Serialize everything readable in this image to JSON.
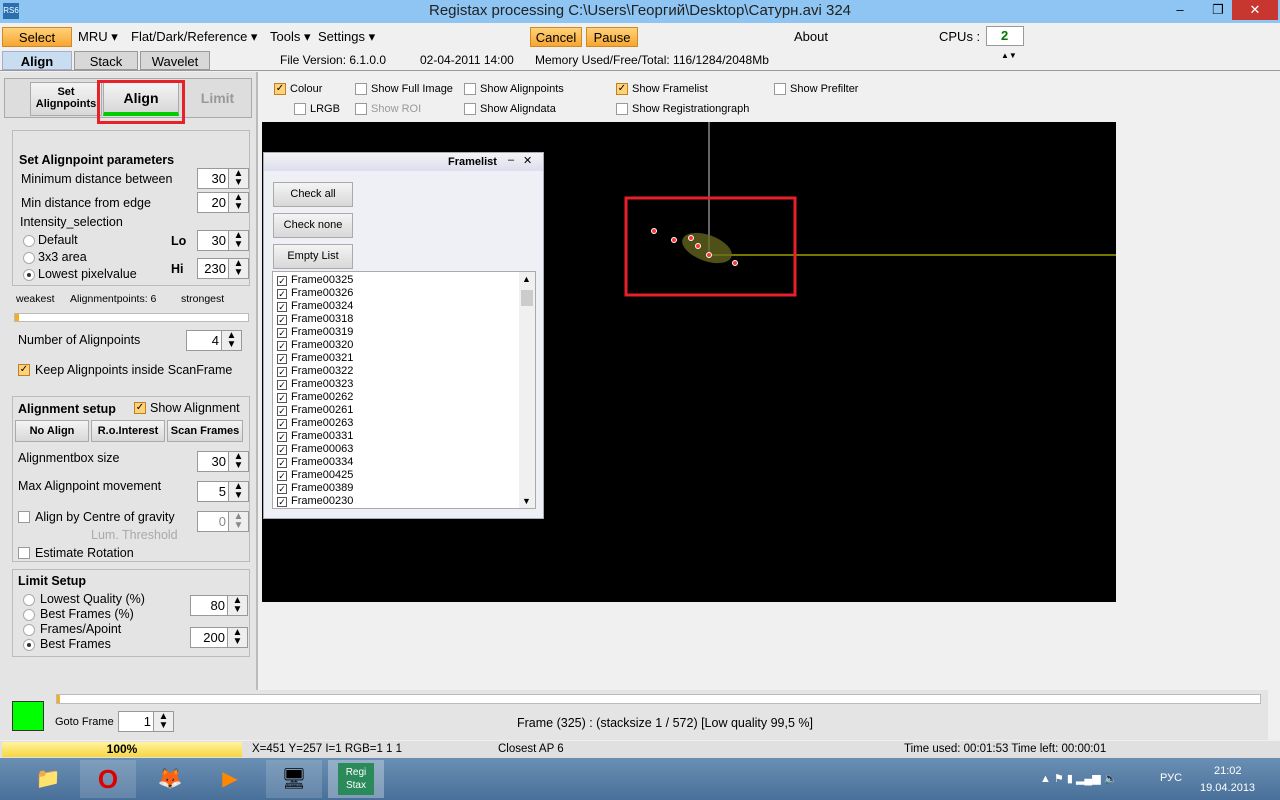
{
  "window": {
    "title": "Registax processing C:\\Users\\Георгий\\Desktop\\Сатурн.avi 324",
    "app_icon": "RS6",
    "minimize": "–",
    "restore": "❐",
    "close": "✕"
  },
  "menu": {
    "select": "Select",
    "mru": "MRU ▾",
    "flat": "Flat/Dark/Reference ▾",
    "tools": "Tools ▾",
    "settings": "Settings ▾",
    "cancel": "Cancel",
    "pause": "Pause",
    "about": "About",
    "cpus_label": "CPUs :",
    "cpus_value": "2"
  },
  "tabs": [
    "Align",
    "Stack",
    "Wavelet"
  ],
  "info": {
    "version": "File Version: 6.1.0.0",
    "date": "02-04-2011 14:00",
    "memory": "Memory Used/Free/Total: 116/1284/2048Mb"
  },
  "subtabs": {
    "set_alignpoints": "Set Alignpoints",
    "align": "Align",
    "limit": "Limit"
  },
  "options": {
    "colour": "Colour",
    "lrgb": "LRGB",
    "show_full_image": "Show Full Image",
    "show_roi": "Show ROI",
    "show_alignpoints": "Show Alignpoints",
    "show_aligndata": "Show Aligndata",
    "show_framelist": "Show Framelist",
    "show_registrationgraph": "Show Registrationgraph",
    "show_prefilter": "Show Prefilter"
  },
  "alignpoint": {
    "heading": "Set Alignpoint parameters",
    "min_between": "Minimum distance between",
    "min_between_val": "30",
    "min_edge": "Min distance from edge",
    "min_edge_val": "20",
    "intensity": "Intensity_selection",
    "default": "Default",
    "area": "3x3 area",
    "lowest": "Lowest pixelvalue",
    "lo": "Lo",
    "lo_val": "30",
    "hi": "Hi",
    "hi_val": "230",
    "weakest": "weakest",
    "count": "Alignmentpoints: 6",
    "strongest": "strongest",
    "slider_fraction": 0.0,
    "num_label": "Number of Alignpoints",
    "num_val": "4",
    "keep": "Keep Alignpoints inside ScanFrame"
  },
  "alignment": {
    "heading": "Alignment setup",
    "show": "Show Alignment",
    "no_align": "No Align",
    "roi": "R.o.Interest",
    "scan": "Scan Frames",
    "box_size": "Alignmentbox size",
    "box_size_val": "30",
    "max_move": "Max Alignpoint movement",
    "max_move_val": "5",
    "centre": "Align by Centre of gravity",
    "centre_val": "0",
    "lum": "Lum. Threshold",
    "rotation": "Estimate Rotation"
  },
  "limit": {
    "heading": "Limit Setup",
    "lowest_quality": "Lowest Quality (%)",
    "best_frames_pct": "Best Frames (%)",
    "val1": "80",
    "frames_apoint": "Frames/Apoint",
    "best_frames": "Best Frames",
    "val2": "200"
  },
  "framelist": {
    "title": "Framelist",
    "check_all": "Check all",
    "check_none": "Check none",
    "empty_list": "Empty List",
    "frames": [
      "Frame00325",
      "Frame00326",
      "Frame00324",
      "Frame00318",
      "Frame00319",
      "Frame00320",
      "Frame00321",
      "Frame00322",
      "Frame00323",
      "Frame00262",
      "Frame00261",
      "Frame00263",
      "Frame00331",
      "Frame00063",
      "Frame00334",
      "Frame00425",
      "Frame00389",
      "Frame00230"
    ]
  },
  "bottom": {
    "goto": "Goto Frame",
    "goto_val": "1",
    "frame_info": "Frame (325) :  (stacksize 1 / 572) [Low quality 99,5 %]"
  },
  "status": {
    "progress": "100%",
    "progress_fraction": 1.0,
    "coords": "X=451 Y=257 I=1 RGB=1 1 1",
    "closest": "Closest AP 6",
    "time": "Time used: 00:01:53 Time left: 00:00:01"
  },
  "taskbar": {
    "lang": "РУС",
    "time": "21:02",
    "date": "19.04.2013",
    "registax": "Regi Stax"
  }
}
